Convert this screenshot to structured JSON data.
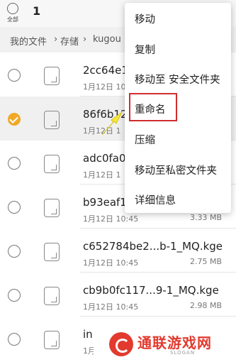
{
  "header": {
    "select_all_label": "全部",
    "selected_count": "1"
  },
  "breadcrumb": {
    "root": "我的文件",
    "storage": "存储",
    "folder": "kugou"
  },
  "files": [
    {
      "name": "2cc64e1",
      "date": "1月12日 10:4",
      "size": "",
      "selected": false
    },
    {
      "name": "86f6b12",
      "date": "1月12日 1",
      "size": "",
      "selected": true
    },
    {
      "name": "adc0fa0",
      "date": "1月12日 1",
      "size": "",
      "selected": false
    },
    {
      "name": "b93eaf1",
      "date": "1月12日 10:45",
      "size": "3.33 MB",
      "selected": false
    },
    {
      "name": "c652784be2...b-1_MQ.kge",
      "date": "1月12日 10:45",
      "size": "2.75 MB",
      "selected": false
    },
    {
      "name": "cb9b0fc117...9-1_MQ.kge",
      "date": "1月12日 10:45",
      "size": "2.98 MB",
      "selected": false
    },
    {
      "name": "in",
      "date": "1月1",
      "size": "",
      "selected": false
    }
  ],
  "menu": {
    "items": [
      "移动",
      "复制",
      "移动至 安全文件夹",
      "重命名",
      "压缩",
      "移动至私密文件夹",
      "详细信息"
    ],
    "highlighted": "重命名"
  },
  "watermark": {
    "text": "通联游戏网",
    "slogan": "SLOGAN"
  },
  "colors": {
    "accent": "#f0a926",
    "highlight_box": "#d02d2d",
    "watermark_red": "#e23a2e"
  }
}
